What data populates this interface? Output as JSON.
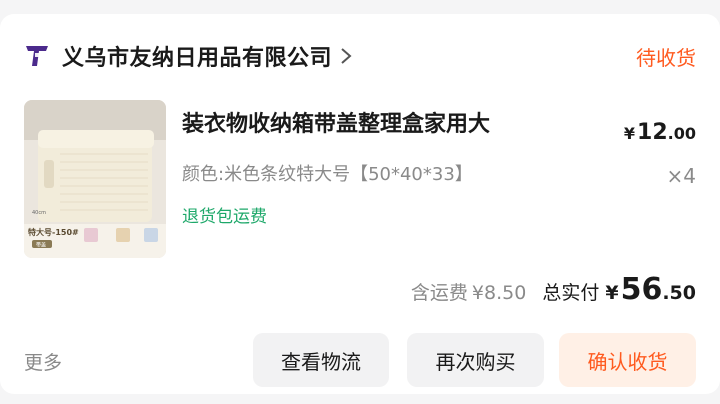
{
  "shop": {
    "name": "义乌市友纳日用品有限公司",
    "order_status": "待收货"
  },
  "product": {
    "title": "装衣物收纳箱带盖整理盒家用大",
    "spec": "颜色:米色条纹特大号【50*40*33】",
    "return_tag": "退货包运费",
    "price_currency": "¥",
    "price_int": "12",
    "price_dec": ".00",
    "quantity": "×4",
    "image_label": "特大号-150#",
    "image_badge": "带盖",
    "image_dim": "40cm"
  },
  "totals": {
    "shipping_label": "含运费",
    "shipping_amount": "¥8.50",
    "paid_label": "总实付",
    "currency": "¥",
    "amount_int": "56",
    "amount_dec": ".50"
  },
  "actions": {
    "more": "更多",
    "logistics": "查看物流",
    "rebuy": "再次购买",
    "confirm": "确认收货"
  },
  "colors": {
    "accent": "#ff5a1f",
    "green": "#1ea86a",
    "logo": "#4b2a8c"
  },
  "icons": {
    "shop_logo": "shop-logo-icon",
    "chevron": "chevron-right-icon"
  }
}
